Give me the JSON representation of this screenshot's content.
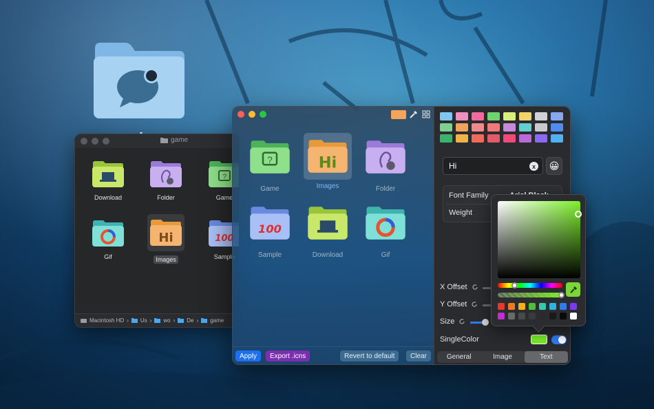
{
  "finder": {
    "title": "game",
    "items": [
      {
        "label": "Download",
        "icon": "laptop-folder-icon"
      },
      {
        "label": "Folder",
        "icon": "ear-folder-icon"
      },
      {
        "label": "Game",
        "icon": "question-folder-icon"
      },
      {
        "label": "Gif",
        "icon": "ring-folder-icon"
      },
      {
        "label": "Images",
        "icon": "hi-folder-icon"
      },
      {
        "label": "Sample",
        "icon": "hundred-folder-icon"
      }
    ],
    "path": [
      "Macintosh HD",
      "Us",
      "wo",
      "De",
      "game"
    ]
  },
  "app": {
    "grid_items": [
      {
        "label": "Game"
      },
      {
        "label": "Images"
      },
      {
        "label": "Folder"
      },
      {
        "label": "Sample"
      },
      {
        "label": "Download"
      },
      {
        "label": "Gif"
      }
    ],
    "tool_swatch_color": "#f5a55a",
    "buttons": {
      "apply": "Apply",
      "export": "Export .icns",
      "revert": "Revert to default",
      "clear": "Clear"
    },
    "palette": [
      "#7ec8f0",
      "#f08fc0",
      "#f06a9a",
      "#6fd46f",
      "#d8ef7a",
      "#f0d36a",
      "#cfd3d8",
      "#86a8f0",
      "#7fcf8f",
      "#f0a35c",
      "#f08a8a",
      "#f07a7a",
      "#c78ad8",
      "#63cfcf",
      "#c9c9cf",
      "#4f8cf0",
      "#3bb36a",
      "#f0b34a",
      "#f06a5a",
      "#e05a6a",
      "#f04a7a",
      "#b86ad8",
      "#8a6af0",
      "#50b0f0",
      "#2fbfae",
      "#3a9a50",
      "#a8d040"
    ],
    "text_value": "Hi",
    "clear_symbol": "x",
    "emoji": "😀",
    "font_family_label": "Font Family",
    "font_family_value": "Arial Black",
    "weight_label": "Weight",
    "x_offset_label": "X Offset",
    "y_offset_label": "Y Offset",
    "size_label": "Size",
    "size_value_fraction": 0.85,
    "single_color_label": "SingleColor",
    "single_color": "#7cf02a",
    "single_color_enabled": true,
    "tabs": [
      "General",
      "Image",
      "Text"
    ],
    "active_tab": "Text"
  },
  "picker": {
    "hue_color": "#7cf02a",
    "hue_fraction": 0.25,
    "alpha_fraction": 1.0,
    "swatches": [
      "#e8392e",
      "#f07a1e",
      "#f0b41a",
      "#4fbf3a",
      "#3ac9a8",
      "#2fb4e0",
      "#2f7cf0",
      "#7a3af0",
      "#c02fd0",
      "#6a6a6a",
      "#4a4a4a",
      "#3a3a3a",
      "#2a2a2a",
      "#1a1a1a",
      "#0a0a0a",
      "#ffffff"
    ]
  }
}
